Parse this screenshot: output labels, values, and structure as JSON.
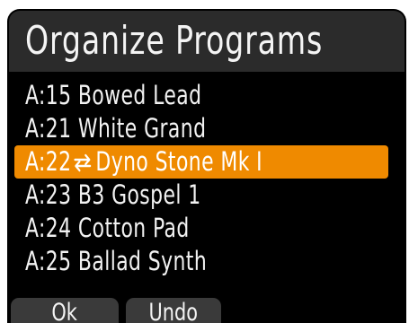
{
  "header": {
    "title": "Organize Programs"
  },
  "programs": [
    {
      "label": "A:15 Bowed Lead",
      "selected": false
    },
    {
      "label": "A:21 White Grand",
      "selected": false
    },
    {
      "bank_num": "A:22",
      "icon": "swap-arrows-icon",
      "name": "Dyno Stone Mk I",
      "selected": true
    },
    {
      "label": "A:23 B3 Gospel 1",
      "selected": false
    },
    {
      "label": "A:24 Cotton Pad",
      "selected": false
    },
    {
      "label": "A:25 Ballad Synth",
      "selected": false
    }
  ],
  "buttons": {
    "ok_label": "Ok",
    "undo_label": "Undo"
  },
  "colors": {
    "background": "#000000",
    "header": "#2b2b2b",
    "selection": "#ef8a00",
    "text": "#f2f2f2"
  }
}
